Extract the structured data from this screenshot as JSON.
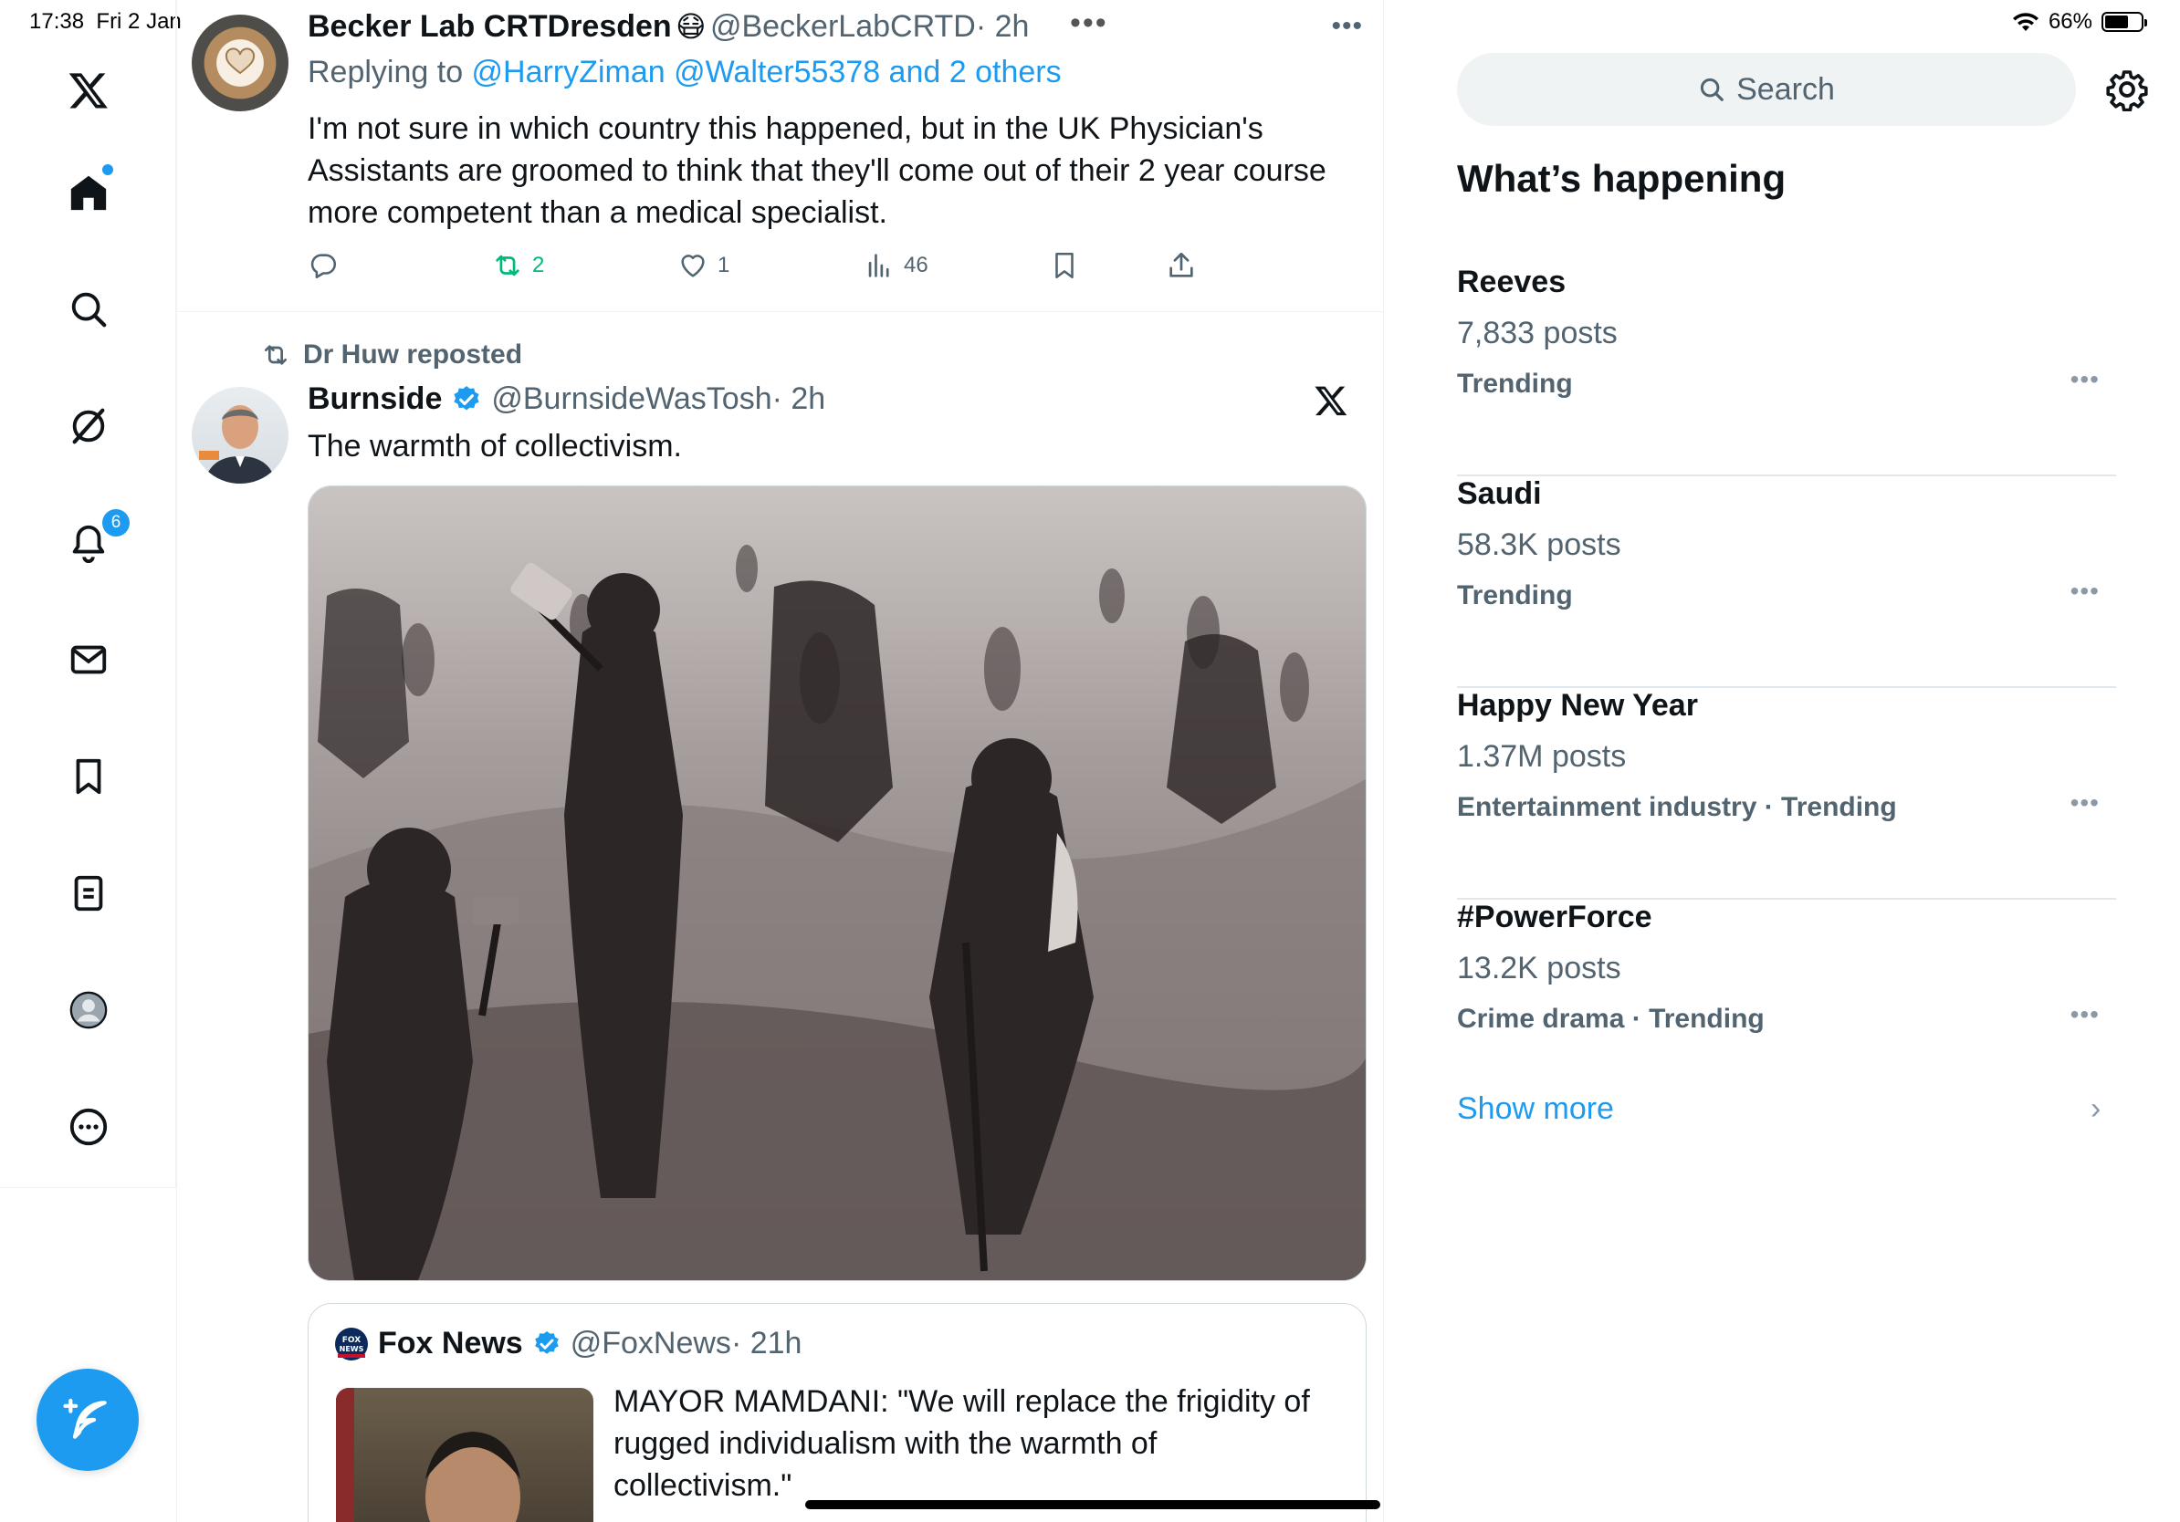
{
  "status_bar": {
    "time": "17:38",
    "date": "Fri 2 Jan",
    "battery": "66%",
    "battery_level": 0.66
  },
  "nav": {
    "items": [
      "X logo",
      "Home",
      "Search",
      "Grok",
      "Notifications",
      "Messages",
      "Bookmarks",
      "Lists",
      "Profile",
      "More"
    ],
    "notifications_badge": "6",
    "compose_label": "Post"
  },
  "timeline": {
    "reply_tweet": {
      "author_name": "Becker Lab CRTDresden",
      "emoji": "😷",
      "handle": "@BeckerLabCRTD",
      "time": "· 2h",
      "replying_prefix": "Replying to ",
      "replying_to": "@HarryZiman @Walter55378 and 2 others",
      "text": "I'm not sure in which country this happened, but in the UK Physician's Assistants are groomed to think that they'll come out of their 2 year course more competent than a medical specialist.",
      "retweets": "2",
      "likes": "1",
      "views": "46",
      "more": "•••"
    },
    "repost_tweet": {
      "reposted_by": "Dr Huw reposted",
      "author_name": "Burnside",
      "handle": "@BurnsideWasTosh",
      "time": "· 2h",
      "text": "The warmth of collectivism."
    },
    "quoted_tweet": {
      "author_name": "Fox News",
      "handle": "@FoxNews",
      "time": "· 21h",
      "text": "MAYOR MAMDANI: \"We will replace the frigidity of rugged individualism with the warmth of collectivism.\""
    }
  },
  "sidebar": {
    "search_placeholder": "Search",
    "section_title": "What’s happening",
    "trends": [
      {
        "name": "Reeves",
        "posts": "7,833 posts",
        "category": "Trending"
      },
      {
        "name": "Saudi",
        "posts": "58.3K posts",
        "category": "Trending"
      },
      {
        "name": "Happy New Year",
        "posts": "1.37M posts",
        "category": "Entertainment industry · Trending"
      },
      {
        "name": "#PowerForce",
        "posts": "13.2K posts",
        "category": "Crime drama · Trending"
      }
    ],
    "trend_more": "•••",
    "show_more": "Show more"
  },
  "colors": {
    "accent": "#1d9bf0",
    "retweet_green": "#00ba7c",
    "secondary_text": "#536471"
  }
}
